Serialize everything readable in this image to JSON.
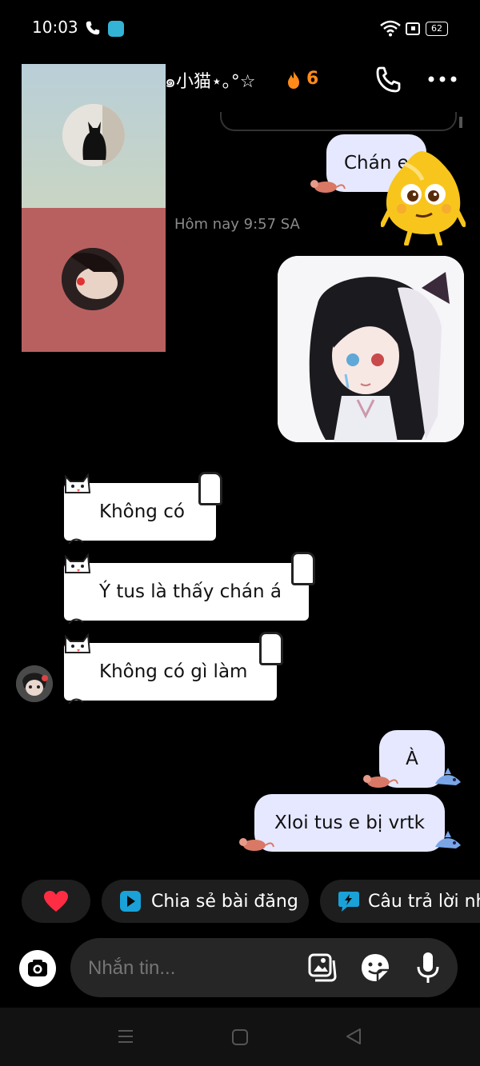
{
  "status_bar": {
    "time": "10:03",
    "battery": "62"
  },
  "header": {
    "title": "˳๑小猫⋆｡°☆",
    "streak_icon": "fire-icon",
    "streak_count": "6"
  },
  "conversation": {
    "sent_1": "Chán e",
    "timestamp": "Hôm nay 9:57 SA",
    "received": [
      "Không có",
      "Ý tus là thấy chán á",
      "Không có gì làm"
    ],
    "sent_2": "À",
    "sent_3": "Xloi tus e bị vrtk"
  },
  "suggestions": {
    "share_post": "Chia sẻ bài đăng",
    "quick_reply": "Câu trả lời nh"
  },
  "composer": {
    "placeholder": "Nhắn tin..."
  },
  "colors": {
    "sent_bubble": "#e6e8ff",
    "streak": "#ff8a1a",
    "background": "#000000"
  }
}
